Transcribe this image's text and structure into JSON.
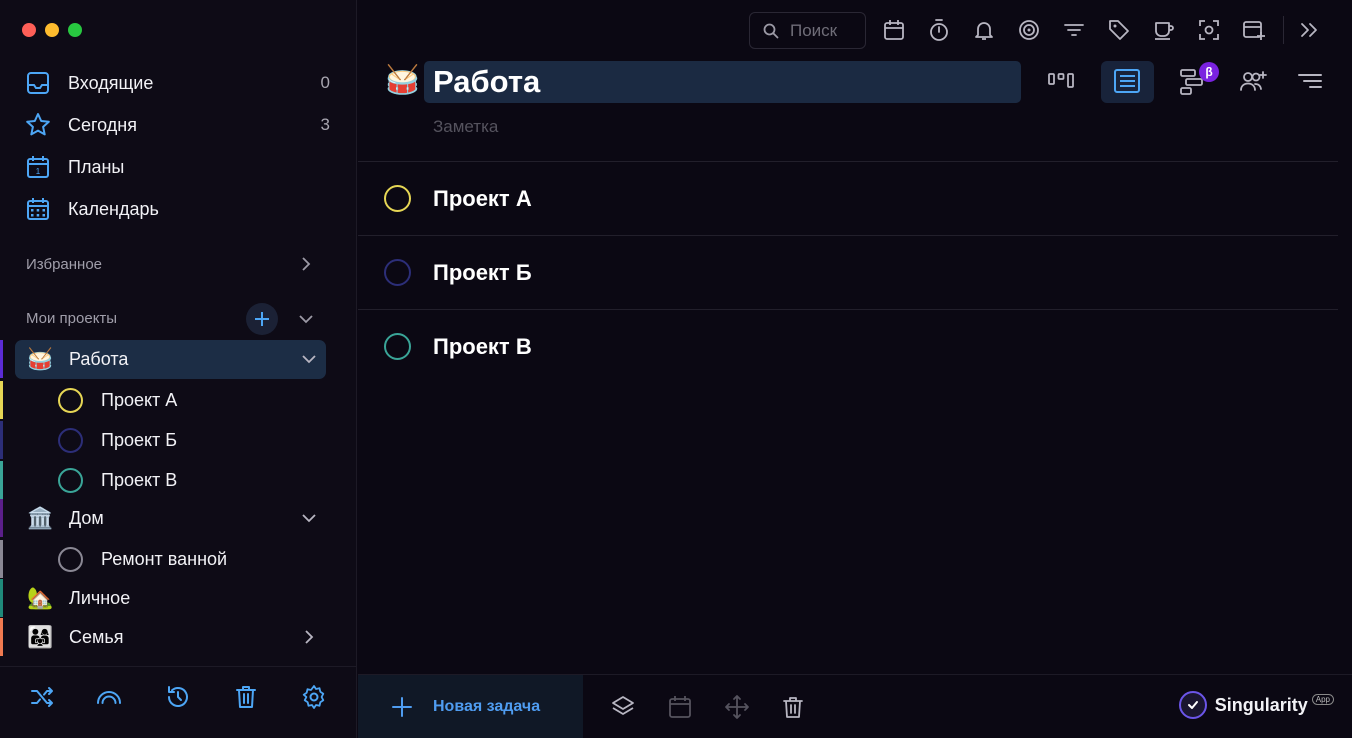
{
  "window": {
    "controls": [
      "close",
      "minimize",
      "zoom"
    ]
  },
  "sidebar": {
    "nav": [
      {
        "label": "Входящие",
        "count": "0",
        "icon": "inbox-icon"
      },
      {
        "label": "Сегодня",
        "count": "3",
        "icon": "star-icon"
      },
      {
        "label": "Планы",
        "count": "",
        "icon": "calendar-day-icon"
      },
      {
        "label": "Календарь",
        "count": "",
        "icon": "calendar-grid-icon"
      }
    ],
    "favorites_title": "Избранное",
    "projects_title": "Мои проекты",
    "projects": [
      {
        "emoji": "🥁",
        "label": "Работа",
        "stripe": "#5b2bd6",
        "expanded": true,
        "active": true,
        "children": [
          {
            "label": "Проект А",
            "ring": "#e6d655",
            "stripe": "#e6d655"
          },
          {
            "label": "Проект Б",
            "ring": "#2c2e78",
            "stripe": "#2c2e78"
          },
          {
            "label": "Проект В",
            "ring": "#3aa598",
            "stripe": "#3aa598"
          }
        ]
      },
      {
        "emoji": "🏛️",
        "label": "Дом",
        "stripe": "#5b1f8a",
        "expanded": true,
        "children": [
          {
            "label": "Ремонт ванной",
            "ring": "#8a8894",
            "stripe": "#8a8894"
          }
        ]
      },
      {
        "emoji": "🏡",
        "label": "Личное",
        "stripe": "#1f8a7a",
        "expanded": false
      },
      {
        "emoji": "👨‍👩‍👧",
        "label": "Семья",
        "stripe": "#f07a50",
        "expanded": false
      }
    ],
    "footer_icons": [
      "shuffle-icon",
      "rainbow-icon",
      "history-icon",
      "trash-icon",
      "settings-icon"
    ]
  },
  "toolbar": {
    "search_placeholder": "Поиск",
    "icons": [
      "calendar-icon",
      "timer-icon",
      "bell-icon",
      "target-icon",
      "filter-icon",
      "tag-icon",
      "coffee-icon",
      "focus-icon",
      "add-window-icon",
      "expand-icon"
    ]
  },
  "project": {
    "emoji": "🥁",
    "title": "Работа",
    "note_placeholder": "Заметка",
    "views": [
      "kanban-view-icon",
      "list-view-icon",
      "gantt-view-icon",
      "share-users-icon",
      "sort-icon"
    ],
    "beta_label": "β"
  },
  "tasks": [
    {
      "label": "Проект А",
      "ring": "#e6d655"
    },
    {
      "label": "Проект Б",
      "ring": "#2c2e78"
    },
    {
      "label": "Проект В",
      "ring": "#3aa598"
    }
  ],
  "footer": {
    "new_task_label": "Новая задача",
    "icons": [
      "layers-icon",
      "calendar-icon",
      "move-icon",
      "trash-icon"
    ],
    "brand_name": "Singularity",
    "brand_tag": "App"
  },
  "colors": {
    "accent": "#4f9cf0",
    "active_row": "#1c2d45",
    "title_field": "#1b2a42"
  }
}
